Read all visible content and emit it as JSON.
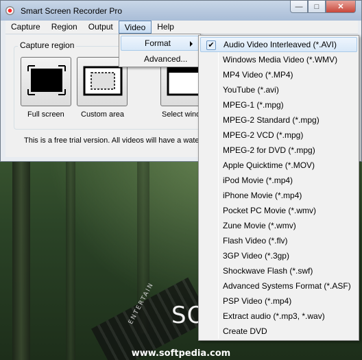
{
  "window": {
    "title": "Smart Screen Recorder Pro"
  },
  "menubar": [
    "Capture",
    "Region",
    "Output",
    "Video",
    "Help"
  ],
  "main": {
    "group_label": "Capture region",
    "tiles": [
      "Full screen",
      "Custom area",
      "Select wind"
    ],
    "trial_text": "This is a free trial version. All videos will have a water"
  },
  "video_menu": {
    "items": [
      "Format",
      "Advanced..."
    ]
  },
  "format_submenu": {
    "checked": "Audio Video Interleaved (*.AVI)",
    "items": [
      "Audio Video Interleaved (*.AVI)",
      "Windows Media Video (*.WMV)",
      "MP4 Video (*.MP4)",
      "YouTube (*.avi)",
      "MPEG-1 (*.mpg)",
      "MPEG-2 Standard (*.mpg)",
      "MPEG-2 VCD (*.mpg)",
      "MPEG-2 for DVD (*.mpg)",
      "Apple Quicktime (*.MOV)",
      "iPod Movie (*.mp4)",
      "iPhone Movie (*.mp4)",
      "Pocket PC Movie (*.wmv)",
      "Zune Movie (*.wmv)",
      "Flash Video (*.flv)",
      "3GP Video (*.3gp)",
      "Shockwave Flash (*.swf)",
      "Advanced Systems Format (*.ASF)",
      "PSP Video (*.mp4)",
      "Extract audio (*.mp3, *.wav)",
      "Create DVD"
    ]
  },
  "background": {
    "brand_text": "SO",
    "film_text": "ENTERTAIN",
    "url": "www.softpedia.com"
  }
}
